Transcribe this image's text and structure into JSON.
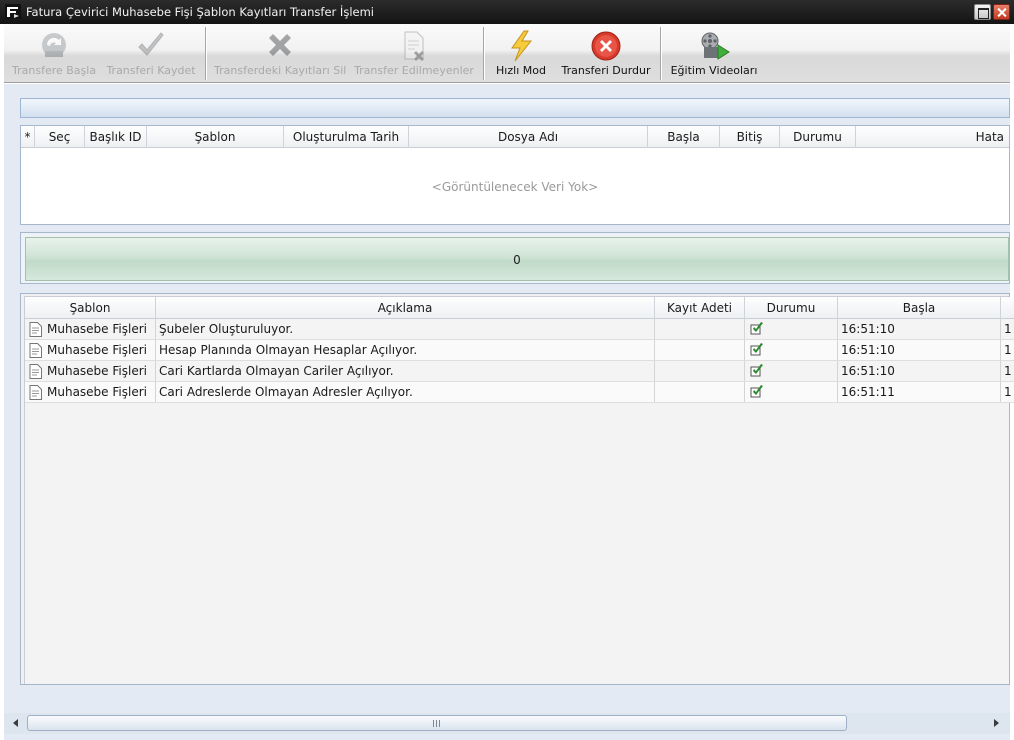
{
  "window": {
    "title": "Fatura Çevirici Muhasebe Fişi Şablon Kayıtları Transfer İşlemi"
  },
  "toolbar": {
    "buttons": [
      {
        "label": "Transfere Başla",
        "icon": "start-transfer-icon",
        "enabled": false
      },
      {
        "label": "Transferi Kaydet",
        "icon": "checkmark-icon",
        "enabled": false
      },
      {
        "label": "Transferdeki Kayıtları Sil",
        "icon": "delete-x-icon",
        "enabled": false
      },
      {
        "label": "Transfer Edilmeyenler",
        "icon": "document-x-icon",
        "enabled": false
      },
      {
        "label": "Hızlı Mod",
        "icon": "lightning-icon",
        "enabled": true
      },
      {
        "label": "Transferi Durdur",
        "icon": "stop-icon",
        "enabled": true
      },
      {
        "label": "Eğitim Videoları",
        "icon": "film-play-icon",
        "enabled": true
      }
    ]
  },
  "header_grid": {
    "columns": [
      "*",
      "Seç",
      "Başlık ID",
      "Şablon",
      "Oluşturulma Tarih",
      "Dosya Adı",
      "Başla",
      "Bitiş",
      "Durumu",
      "Hata"
    ],
    "empty_text": "<Görüntülenecek Veri Yok>"
  },
  "progress": {
    "value": "0"
  },
  "log_grid": {
    "columns": [
      "Şablon",
      "Açıklama",
      "Kayıt Adeti",
      "Durumu",
      "Başla"
    ],
    "rows": [
      {
        "template": "Muhasebe Fişleri",
        "description": "Şubeler Oluşturuluyor.",
        "count": "",
        "status": "success",
        "start": "16:51:10",
        "overflow": "1"
      },
      {
        "template": "Muhasebe Fişleri",
        "description": "Hesap Planında Olmayan Hesaplar Açılıyor.",
        "count": "",
        "status": "success",
        "start": "16:51:10",
        "overflow": "1"
      },
      {
        "template": "Muhasebe Fişleri",
        "description": "Cari Kartlarda Olmayan Cariler Açılıyor.",
        "count": "",
        "status": "success",
        "start": "16:51:10",
        "overflow": "1"
      },
      {
        "template": "Muhasebe Fişleri",
        "description": "Cari Adreslerde Olmayan Adresler Açılıyor.",
        "count": "",
        "status": "success",
        "start": "16:51:11",
        "overflow": "1"
      }
    ]
  },
  "colors": {
    "accent": "#e3eaf4",
    "progress": "#c0dac8",
    "success": "#2f8a2f",
    "stop": "#d8392b"
  }
}
